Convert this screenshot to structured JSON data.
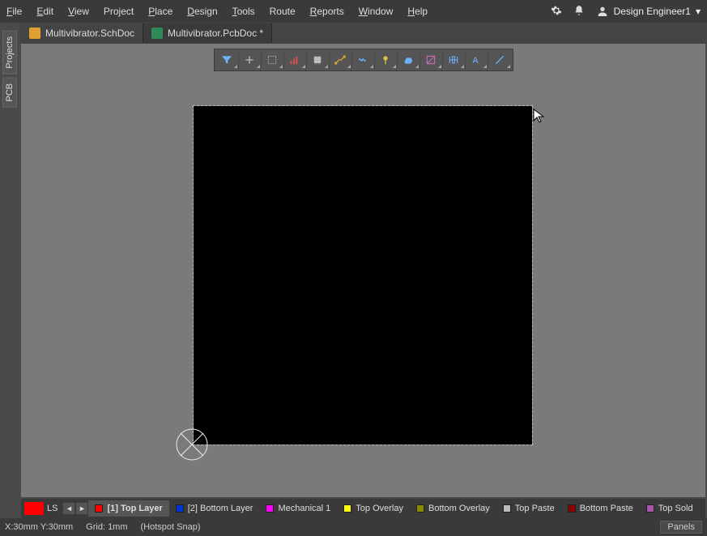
{
  "menu": {
    "file": "File",
    "edit": "Edit",
    "view": "View",
    "project": "Project",
    "place": "Place",
    "design": "Design",
    "tools": "Tools",
    "route": "Route",
    "reports": "Reports",
    "window": "Window",
    "help": "Help"
  },
  "user": {
    "name": "Design Engineer1"
  },
  "tabs": {
    "sch": "Multivibrator.SchDoc",
    "pcb": "Multivibrator.PcbDoc *"
  },
  "side": {
    "projects": "Projects",
    "pcb": "PCB"
  },
  "layers": {
    "ls": "LS",
    "top": "[1] Top Layer",
    "bottom": "[2] Bottom Layer",
    "mech": "Mechanical 1",
    "tover": "Top Overlay",
    "bover": "Bottom Overlay",
    "tpaste": "Top Paste",
    "bpaste": "Bottom Paste",
    "tsold": "Top Sold"
  },
  "colors": {
    "top": "#ff0000",
    "bottom": "#0033cc",
    "mech": "#ff00ff",
    "tover": "#ffff00",
    "bover": "#8a8a00",
    "tpaste": "#bbbbbb",
    "bpaste": "#8b0000",
    "tsold": "#aa55aa"
  },
  "status": {
    "coords": "X:30mm Y:30mm",
    "grid": "Grid: 1mm",
    "snap": "(Hotspot Snap)",
    "panels": "Panels"
  }
}
